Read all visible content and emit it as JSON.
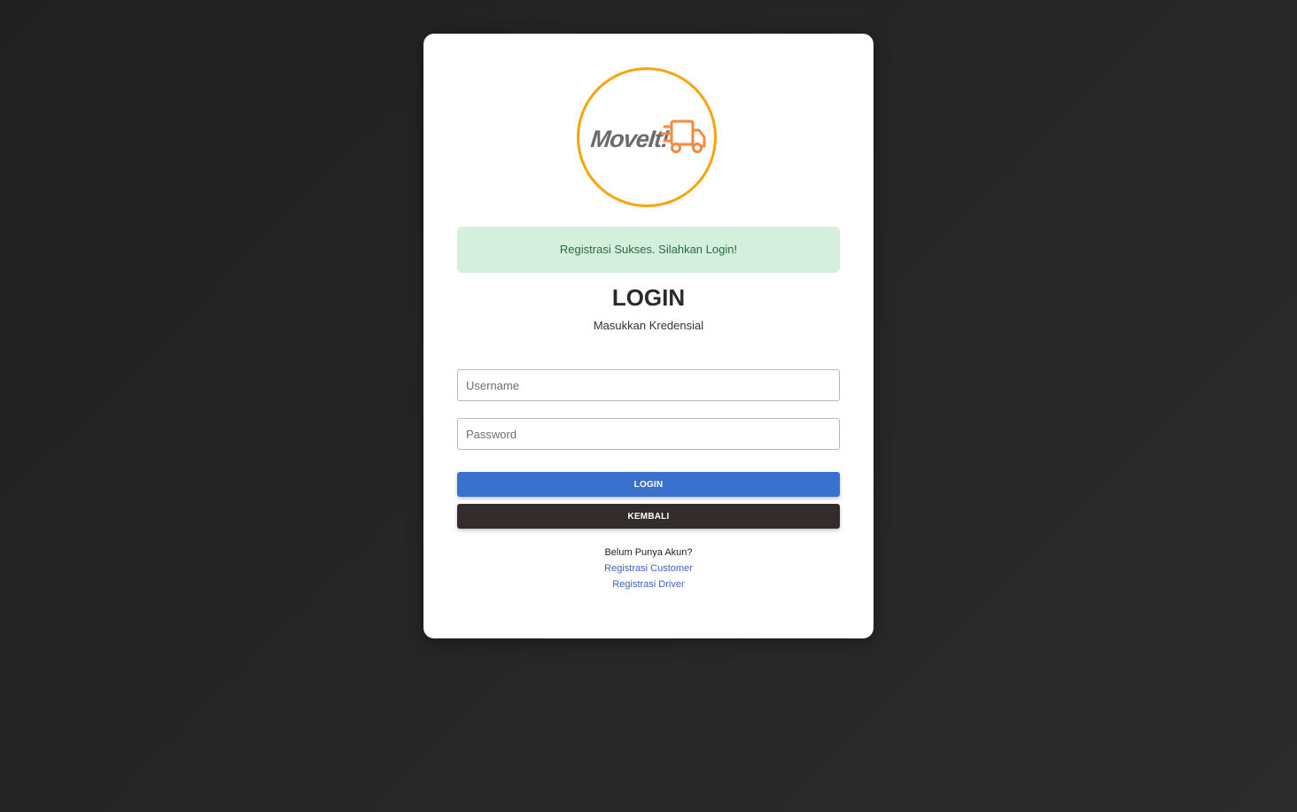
{
  "logo": {
    "text": "MoveIt!",
    "icon": "truck-icon",
    "ring_color": "#f6a609",
    "accent_color": "#f58a3c"
  },
  "alert": {
    "message": "Registrasi Sukses. Silahkan Login!"
  },
  "header": {
    "title": "LOGIN",
    "subtitle": "Masukkan Kredensial"
  },
  "form": {
    "username_placeholder": "Username",
    "password_placeholder": "Password",
    "login_label": "LOGIN",
    "back_label": "KEMBALI"
  },
  "footer": {
    "question": "Belum Punya Akun?",
    "register_customer": "Registrasi Customer",
    "register_driver": "Registrasi Driver"
  },
  "colors": {
    "primary": "#3b71ce",
    "dark": "#332c2c",
    "success_bg": "#d5efdf",
    "success_text": "#2b6b3f",
    "link": "#3b64b8"
  }
}
